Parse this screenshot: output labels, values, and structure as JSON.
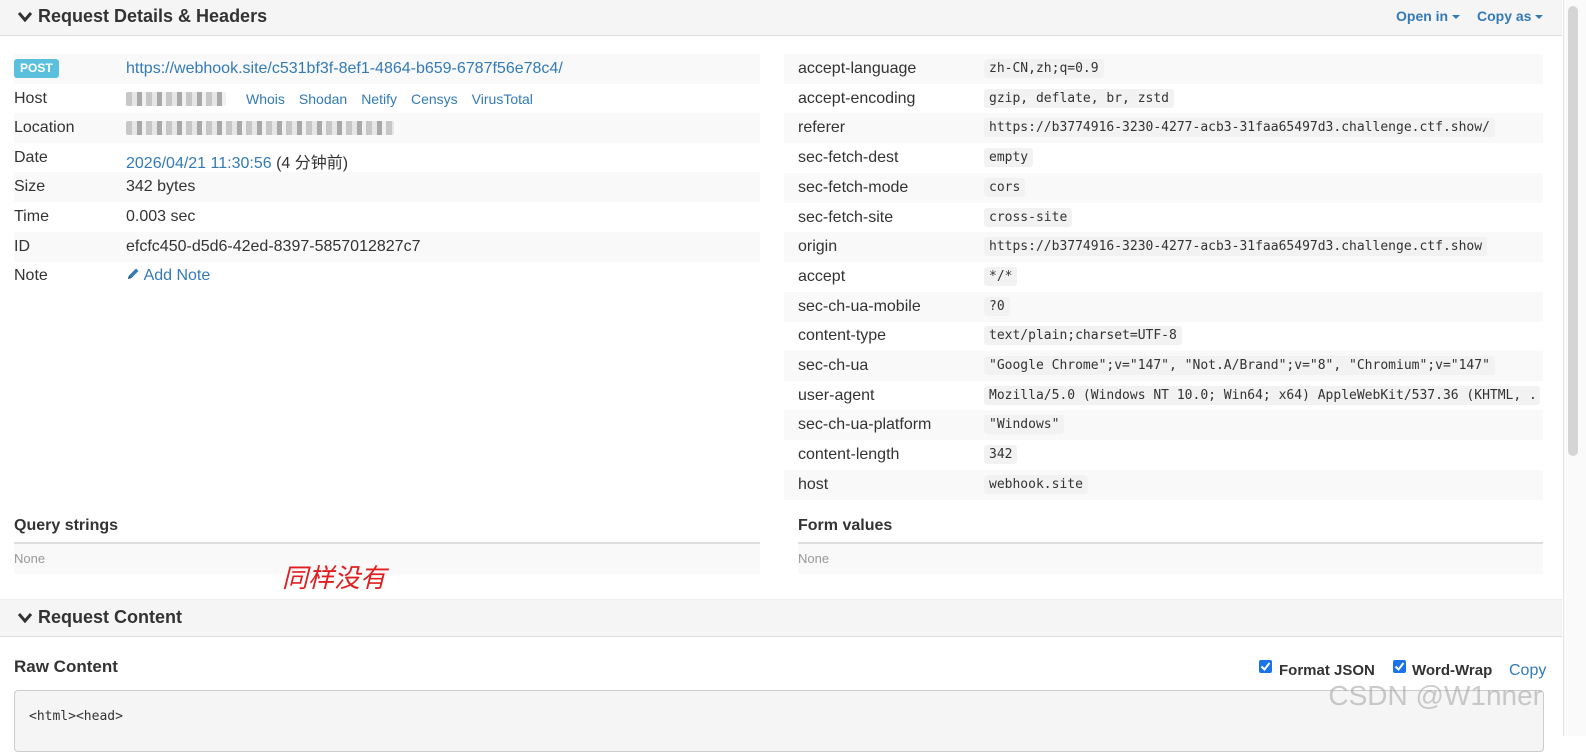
{
  "details": {
    "title": "Request Details & Headers",
    "open_in": "Open in",
    "copy_as": "Copy as",
    "method": "POST",
    "url": "https://webhook.site/c531bf3f-8ef1-4864-b659-6787f56e78c4/",
    "rows": [
      {
        "key": "Host"
      },
      {
        "key": "Location"
      },
      {
        "key": "Date",
        "value": "2026/04/21 11:30:56",
        "suffix": "(4 分钟前)"
      },
      {
        "key": "Size",
        "value": "342 bytes"
      },
      {
        "key": "Time",
        "value": "0.003 sec"
      },
      {
        "key": "ID",
        "value": "efcfc450-d5d6-42ed-8397-5857012827c7"
      },
      {
        "key": "Note",
        "value": "Add Note"
      }
    ],
    "host_links": [
      "Whois",
      "Shodan",
      "Netify",
      "Censys",
      "VirusTotal"
    ]
  },
  "headers": [
    {
      "key": "accept-language",
      "value": "zh-CN,zh;q=0.9"
    },
    {
      "key": "accept-encoding",
      "value": "gzip, deflate, br, zstd"
    },
    {
      "key": "referer",
      "value": "https://b3774916-3230-4277-acb3-31faa65497d3.challenge.ctf.show/"
    },
    {
      "key": "sec-fetch-dest",
      "value": "empty"
    },
    {
      "key": "sec-fetch-mode",
      "value": "cors"
    },
    {
      "key": "sec-fetch-site",
      "value": "cross-site"
    },
    {
      "key": "origin",
      "value": "https://b3774916-3230-4277-acb3-31faa65497d3.challenge.ctf.show"
    },
    {
      "key": "accept",
      "value": "*/*"
    },
    {
      "key": "sec-ch-ua-mobile",
      "value": "?0"
    },
    {
      "key": "content-type",
      "value": "text/plain;charset=UTF-8"
    },
    {
      "key": "sec-ch-ua",
      "value": "\"Google Chrome\";v=\"147\", \"Not.A/Brand\";v=\"8\", \"Chromium\";v=\"147\""
    },
    {
      "key": "user-agent",
      "value": "Mozilla/5.0 (Windows NT 10.0; Win64; x64) AppleWebKit/537.36 (KHTML, ..."
    },
    {
      "key": "sec-ch-ua-platform",
      "value": "\"Windows\""
    },
    {
      "key": "content-length",
      "value": "342"
    },
    {
      "key": "host",
      "value": "webhook.site"
    }
  ],
  "query_strings": {
    "title": "Query strings",
    "value": "None"
  },
  "form_values": {
    "title": "Form values",
    "value": "None"
  },
  "annotation": "同样没有",
  "content": {
    "title": "Request Content",
    "raw_title": "Raw Content",
    "format_json": "Format JSON",
    "word_wrap": "Word-Wrap",
    "copy": "Copy",
    "format_json_checked": true,
    "word_wrap_checked": true,
    "raw_text": "<html><head>"
  },
  "watermark": "CSDN @W1nner"
}
